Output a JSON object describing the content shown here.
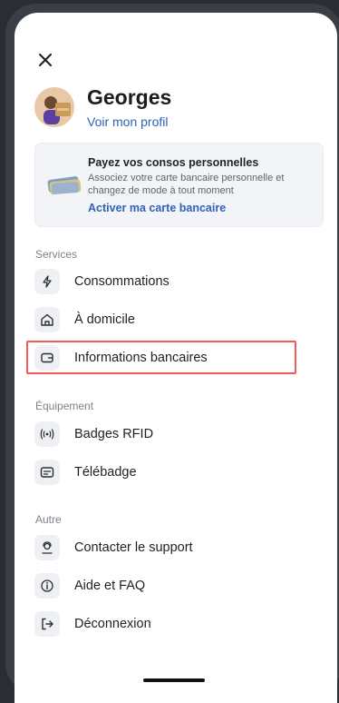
{
  "profile": {
    "name": "Georges",
    "link": "Voir mon profil"
  },
  "promo": {
    "title": "Payez vos consos personnelles",
    "description": "Associez votre carte bancaire personnelle et changez de mode à tout moment",
    "action": "Activer ma carte bancaire"
  },
  "sections": {
    "services": {
      "label": "Services",
      "items": [
        {
          "label": "Consommations",
          "icon": "lightning-icon"
        },
        {
          "label": "À domicile",
          "icon": "home-icon"
        },
        {
          "label": "Informations bancaires",
          "icon": "wallet-icon"
        }
      ]
    },
    "equipement": {
      "label": "Équipement",
      "items": [
        {
          "label": "Badges RFID",
          "icon": "rfid-icon"
        },
        {
          "label": "Télébadge",
          "icon": "telebadge-icon"
        }
      ]
    },
    "autre": {
      "label": "Autre",
      "items": [
        {
          "label": "Contacter le support",
          "icon": "support-icon"
        },
        {
          "label": "Aide et FAQ",
          "icon": "info-icon"
        },
        {
          "label": "Déconnexion",
          "icon": "logout-icon"
        }
      ]
    }
  },
  "colors": {
    "link": "#2f62b8",
    "highlight": "#f25a5a"
  }
}
